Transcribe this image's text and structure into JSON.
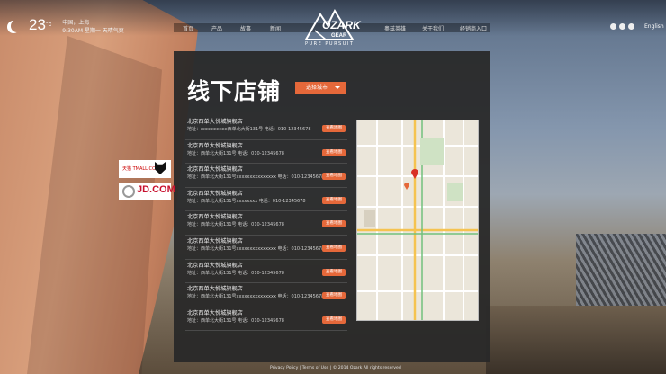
{
  "weather": {
    "temperature": "23",
    "unit": "°c",
    "location": "中国，上海",
    "time_line": "9:30AM  星期一  天晴气爽"
  },
  "nav": {
    "left_items": [
      "首页",
      "产品",
      "故事",
      "新闻"
    ],
    "right_items": [
      "奥兹英雄",
      "关于我们",
      "经销商入口"
    ]
  },
  "logo": {
    "wordmark": "OZARK",
    "submark": "GEAR",
    "tagline": "PURE PURSUIT"
  },
  "header_right": {
    "language": "English",
    "social_icons": [
      "weibo-icon",
      "wechat-icon",
      "qq-icon"
    ]
  },
  "page": {
    "title": "线下店铺",
    "city_select": "选择城市"
  },
  "stores": [
    {
      "name": "北京西单大悦城旗舰店",
      "address": "地址：xxxxxxxxxx西单北大街131号   电话：010-12345678",
      "button": "查看地图"
    },
    {
      "name": "北京西单大悦城旗舰店",
      "address": "地址：西单北大街131号   电话：010-12345678",
      "button": "查看地图"
    },
    {
      "name": "北京西单大悦城旗舰店",
      "address": "地址：西单北大街131号xxxxxxxxxxxxxxx   电话：010-12345678",
      "button": "查看地图"
    },
    {
      "name": "北京西单大悦城旗舰店",
      "address": "地址：西单北大街131号xxxxxxxx   电话：010-12345678",
      "button": "查看地图"
    },
    {
      "name": "北京西单大悦城旗舰店",
      "address": "地址：西单北大街131号   电话：010-12345678",
      "button": "查看地图"
    },
    {
      "name": "北京西单大悦城旗舰店",
      "address": "地址：西单北大街131号xxxxxxxxxxxxxxx   电话：010-12345678",
      "button": "查看地图"
    },
    {
      "name": "北京西单大悦城旗舰店",
      "address": "地址：西单北大街131号   电话：010-12345678",
      "button": "查看地图"
    },
    {
      "name": "北京西单大悦城旗舰店",
      "address": "地址：西单北大街131号xxxxxxxxxxxxxxx   电话：010-12345678",
      "button": "查看地图"
    },
    {
      "name": "北京西单大悦城旗舰店",
      "address": "地址：西单北大街131号   电话：010-12345678",
      "button": "查看地图"
    }
  ],
  "shops_online": {
    "tmall_label": "天猫 TMALL.COM",
    "jd_label": "JD.COM"
  },
  "footer": {
    "text": "Privacy Policy  |  Terms of Use  |  © 2014 Ozark All rights reserved"
  },
  "colors": {
    "accent": "#e5683a",
    "panel": "#282828"
  }
}
